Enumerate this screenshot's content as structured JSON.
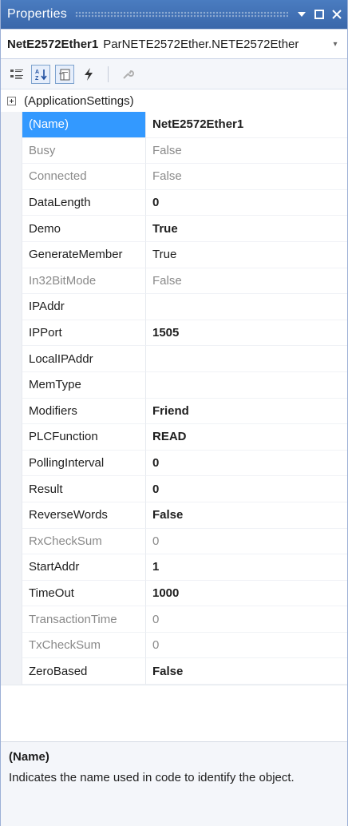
{
  "titlebar": {
    "title": "Properties"
  },
  "selector": {
    "object_name": "NetE2572Ether1",
    "object_type": "ParNETE2572Ether.NETE2572Ether"
  },
  "grid": {
    "category": "(ApplicationSettings)",
    "properties": [
      {
        "name": "(Name)",
        "value": "NetE2572Ether1",
        "state": "selected bold"
      },
      {
        "name": "Busy",
        "value": "False",
        "state": "readonly"
      },
      {
        "name": "Connected",
        "value": "False",
        "state": "readonly"
      },
      {
        "name": "DataLength",
        "value": "0",
        "state": "bold"
      },
      {
        "name": "Demo",
        "value": "True",
        "state": "bold"
      },
      {
        "name": "GenerateMember",
        "value": "True",
        "state": ""
      },
      {
        "name": "In32BitMode",
        "value": "False",
        "state": "readonly"
      },
      {
        "name": "IPAddr",
        "value": "",
        "state": ""
      },
      {
        "name": "IPPort",
        "value": "1505",
        "state": "bold"
      },
      {
        "name": "LocalIPAddr",
        "value": "",
        "state": ""
      },
      {
        "name": "MemType",
        "value": "",
        "state": ""
      },
      {
        "name": "Modifiers",
        "value": "Friend",
        "state": "bold"
      },
      {
        "name": "PLCFunction",
        "value": "READ",
        "state": "bold"
      },
      {
        "name": "PollingInterval",
        "value": "0",
        "state": "bold"
      },
      {
        "name": "Result",
        "value": "0",
        "state": "bold"
      },
      {
        "name": "ReverseWords",
        "value": "False",
        "state": "bold"
      },
      {
        "name": "RxCheckSum",
        "value": "0",
        "state": "readonly"
      },
      {
        "name": "StartAddr",
        "value": "1",
        "state": "bold"
      },
      {
        "name": "TimeOut",
        "value": "1000",
        "state": "bold"
      },
      {
        "name": "TransactionTime",
        "value": "0",
        "state": "readonly"
      },
      {
        "name": "TxCheckSum",
        "value": "0",
        "state": "readonly"
      },
      {
        "name": "ZeroBased",
        "value": "False",
        "state": "bold"
      }
    ]
  },
  "description": {
    "title": "(Name)",
    "text": "Indicates the name used in code to identify the object."
  },
  "icons": {
    "window_position": "chevron-down-icon",
    "maximize": "maximize-icon",
    "close": "close-icon",
    "categorized": "categorized-icon",
    "alphabetical": "alphabetical-sort-icon",
    "properties": "properties-icon",
    "events": "lightning-icon",
    "property_pages": "wrench-icon"
  },
  "colors": {
    "titlebar": "#3f70b5",
    "selection": "#3399ff",
    "readonly_text": "#8a8a8a"
  }
}
